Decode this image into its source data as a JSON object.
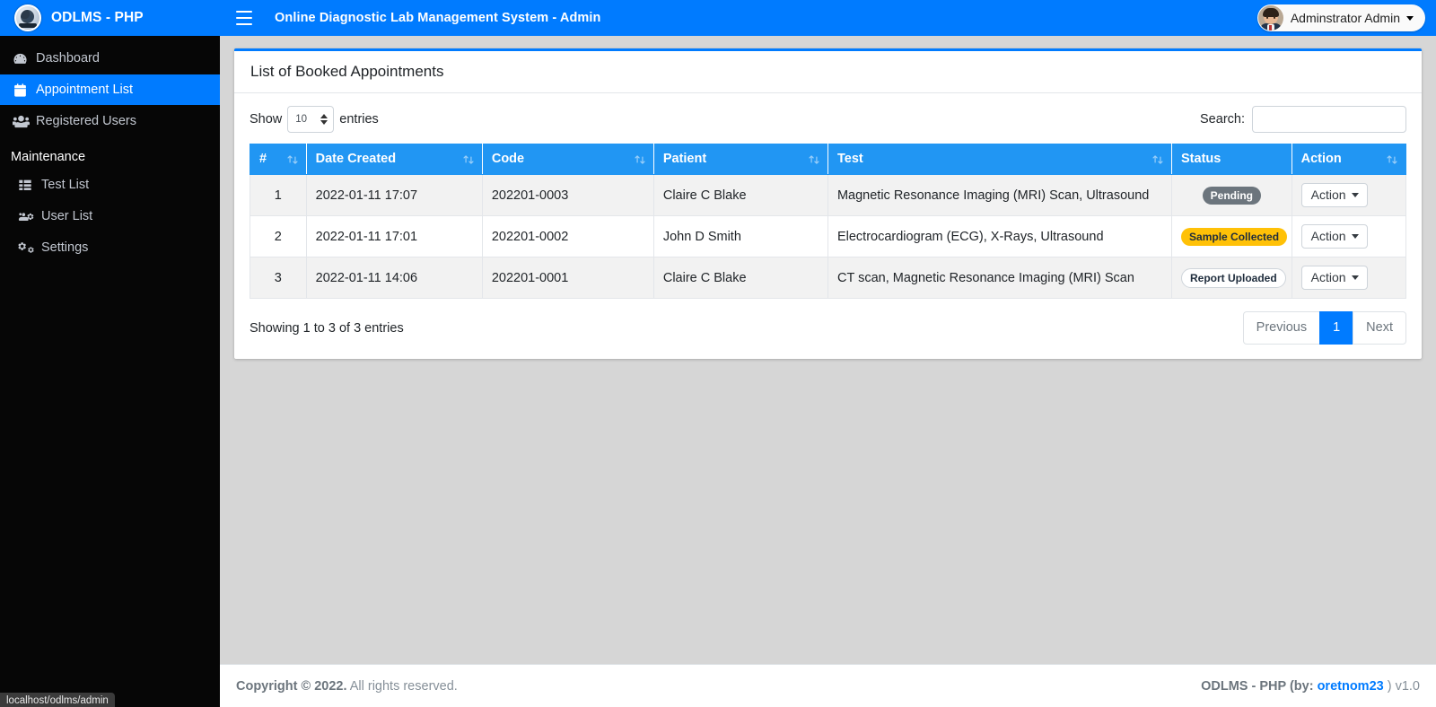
{
  "brand": {
    "logo_icon": "globe-logo-icon",
    "text": "ODLMS - PHP"
  },
  "sidebar": {
    "items": [
      {
        "label": "Dashboard",
        "icon": "tachometer-icon",
        "active": false
      },
      {
        "label": "Appointment List",
        "icon": "calendar-icon",
        "active": true
      },
      {
        "label": "Registered Users",
        "icon": "users-icon",
        "active": false
      }
    ],
    "section_header": "Maintenance",
    "maintenance_items": [
      {
        "label": "Test List",
        "icon": "th-list-icon"
      },
      {
        "label": "User List",
        "icon": "users-cog-icon"
      },
      {
        "label": "Settings",
        "icon": "cogs-icon"
      }
    ]
  },
  "navbar": {
    "menu_icon": "hamburger-icon",
    "title": "Online Diagnostic Lab Management System - Admin",
    "user_name": "Adminstrator Admin",
    "user_avatar_icon": "user-avatar-icon",
    "caret_icon": "caret-down-icon"
  },
  "card": {
    "title": "List of Booked Appointments"
  },
  "datatable": {
    "length_label_before": "Show",
    "length_value": "10",
    "length_label_after": "entries",
    "search_label": "Search:",
    "search_value": "",
    "search_placeholder": "",
    "sort_icon": "sort-updown-icon",
    "columns": [
      {
        "label": "#",
        "sortable": true
      },
      {
        "label": "Date Created",
        "sortable": true
      },
      {
        "label": "Code",
        "sortable": true
      },
      {
        "label": "Patient",
        "sortable": true
      },
      {
        "label": "Test",
        "sortable": true
      },
      {
        "label": "Status",
        "sortable": false
      },
      {
        "label": "Action",
        "sortable": true
      }
    ],
    "rows": [
      {
        "num": "1",
        "date_created": "2022-01-11 17:07",
        "code": "202201-0003",
        "patient": "Claire C Blake",
        "test": "Magnetic Resonance Imaging (MRI) Scan, Ultrasound",
        "status": "Pending",
        "status_style": "secondary",
        "action_label": "Action"
      },
      {
        "num": "2",
        "date_created": "2022-01-11 17:01",
        "code": "202201-0002",
        "patient": "John D Smith",
        "test": "Electrocardiogram (ECG), X-Rays, Ultrasound",
        "status": "Sample Collected",
        "status_style": "warning",
        "action_label": "Action"
      },
      {
        "num": "3",
        "date_created": "2022-01-11 14:06",
        "code": "202201-0001",
        "patient": "Claire C Blake",
        "test": "CT scan, Magnetic Resonance Imaging (MRI) Scan",
        "status": "Report Uploaded",
        "status_style": "light",
        "action_label": "Action"
      }
    ],
    "info": "Showing 1 to 3 of 3 entries",
    "pagination": {
      "previous": "Previous",
      "pages": [
        "1"
      ],
      "next": "Next",
      "active_page": "1"
    }
  },
  "footer": {
    "copyright_strong": "Copyright © 2022.",
    "copyright_rest": " All rights reserved.",
    "right_prefix": "ODLMS - PHP (by: ",
    "right_link": "oretnom23",
    "right_suffix": " ) v1.0"
  },
  "status_tip": {
    "url": "localhost/odlms/admin"
  },
  "colors": {
    "brand_blue": "#007bff",
    "table_header_blue": "#2196f3",
    "sidebar_dark": "#060606",
    "badge_warning": "#ffc107",
    "badge_secondary": "#6c757d",
    "content_bg": "#d6d6d6"
  }
}
